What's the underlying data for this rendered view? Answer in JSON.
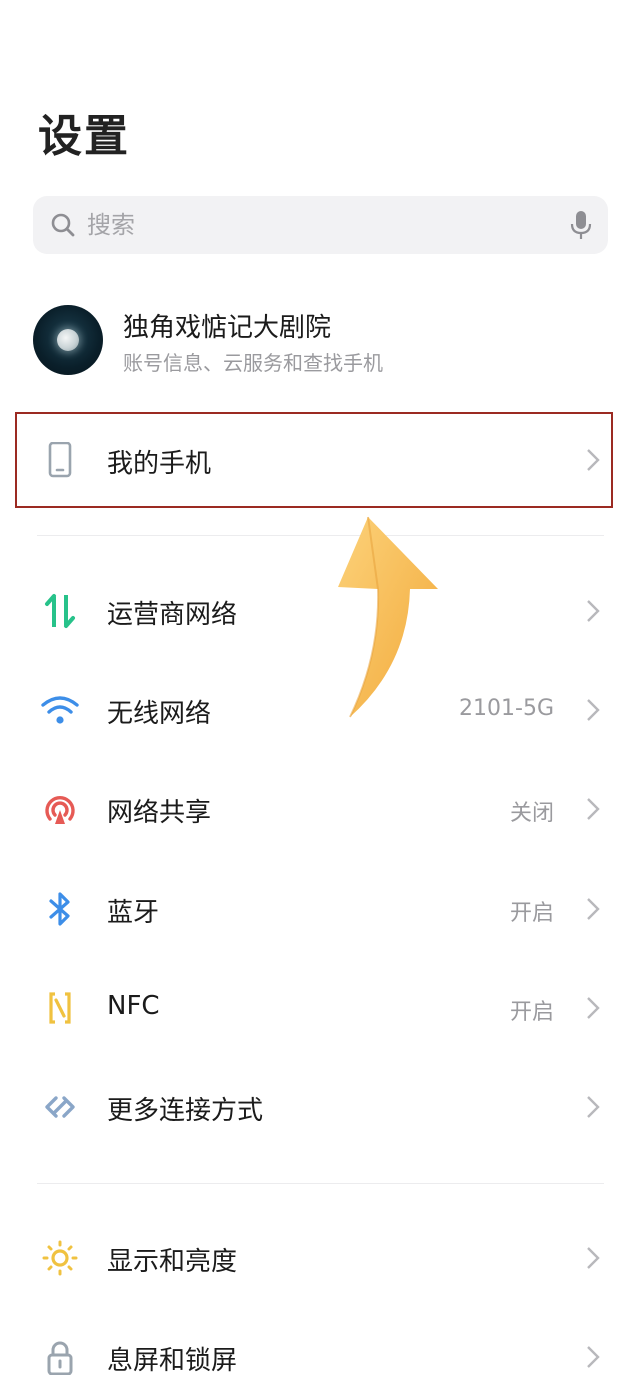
{
  "header": {
    "title": "设置"
  },
  "search": {
    "placeholder": "搜索",
    "value": ""
  },
  "account": {
    "name": "独角戏惦记大剧院",
    "subtitle": "账号信息、云服务和查找手机"
  },
  "settings": {
    "my_phone": {
      "label": "我的手机"
    },
    "carrier_network": {
      "label": "运营商网络"
    },
    "wifi": {
      "label": "无线网络",
      "value": "2101-5G"
    },
    "hotspot": {
      "label": "网络共享",
      "value": "关闭"
    },
    "bluetooth": {
      "label": "蓝牙",
      "value": "开启"
    },
    "nfc": {
      "label": "NFC",
      "value": "开启"
    },
    "more_connections": {
      "label": "更多连接方式"
    },
    "display": {
      "label": "显示和亮度"
    },
    "lock_screen": {
      "label": "息屏和锁屏"
    }
  },
  "colors": {
    "highlight_border": "#9b2a22",
    "annotation_arrow": "#f7b84a",
    "carrier_icon": "#27c28a",
    "wifi_icon": "#3d8ee8",
    "hotspot_icon": "#e65a55",
    "bluetooth_icon": "#3d8ee8",
    "nfc_icon": "#f0c240",
    "more_icon": "#8aa6c8",
    "display_icon": "#f0c240",
    "lock_icon": "#9aa4ae"
  },
  "icons": {
    "search": "search-icon",
    "mic": "microphone-icon",
    "my_phone": "phone-icon",
    "carrier_network": "signal-arrows-icon",
    "wifi": "wifi-icon",
    "hotspot": "hotspot-icon",
    "bluetooth": "bluetooth-icon",
    "nfc": "nfc-icon",
    "more_connections": "link-icon",
    "display": "sun-icon",
    "lock_screen": "lock-icon",
    "chevron": "chevron-right-icon"
  }
}
